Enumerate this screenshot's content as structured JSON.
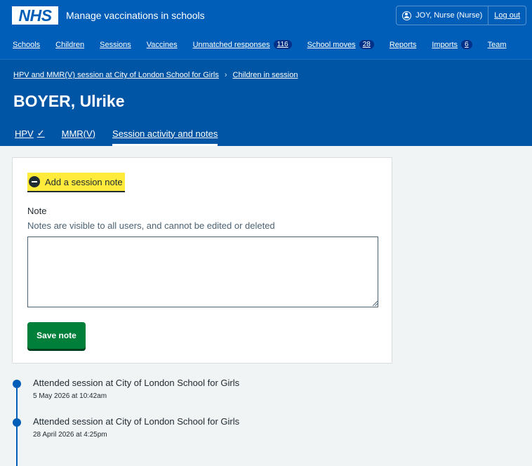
{
  "header": {
    "logo": "NHS",
    "service_name": "Manage vaccinations in schools",
    "user": "JOY, Nurse (Nurse)",
    "logout": "Log out"
  },
  "nav": [
    {
      "label": "Schools"
    },
    {
      "label": "Children"
    },
    {
      "label": "Sessions"
    },
    {
      "label": "Vaccines"
    },
    {
      "label": "Unmatched responses",
      "badge": "116"
    },
    {
      "label": "School moves",
      "badge": "28"
    },
    {
      "label": "Reports"
    },
    {
      "label": "Imports",
      "badge": "6"
    },
    {
      "label": "Team"
    }
  ],
  "breadcrumbs": {
    "session": "HPV and MMR(V) session at City of London School for Girls",
    "children": "Children in session",
    "separator": "›"
  },
  "page_title": "BOYER, Ulrike",
  "tabs": {
    "hpv": "HPV",
    "hpv_status": "✓",
    "mmrv": "MMR(V)",
    "activity": "Session activity and notes"
  },
  "note_form": {
    "toggle_label": "Add a session note",
    "label": "Note",
    "hint": "Notes are visible to all users, and cannot be edited or deleted",
    "value": "",
    "save_label": "Save note"
  },
  "events": [
    {
      "title": "Attended session at City of London School for Girls",
      "time": "5 May 2026 at 10:42am"
    },
    {
      "title": "Attended session at City of London School for Girls",
      "time": "28 April 2026 at 4:25pm"
    }
  ],
  "colors": {
    "nhs_blue": "#005eb8",
    "highlight_yellow": "#ffeb3b",
    "button_green": "#007f3b"
  }
}
